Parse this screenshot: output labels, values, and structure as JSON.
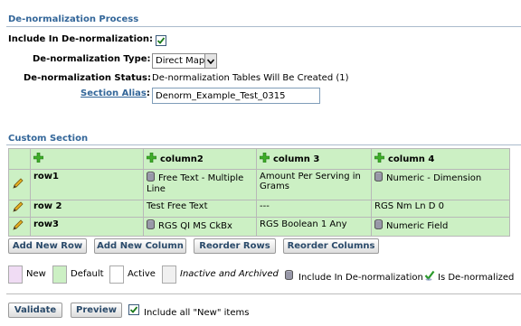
{
  "denorm": {
    "title": "De-normalization Process",
    "include_label": "Include In De-normalization:",
    "include_checked": true,
    "type_label": "De-normalization Type:",
    "type_value": "Direct Map",
    "status_label": "De-normalization Status:",
    "status_value": "De-normalization Tables Will Be Created (1)",
    "alias_label": "Section Alias",
    "alias_colon": ":",
    "alias_value": "Denorm_Example_Test_0315"
  },
  "custom": {
    "title": "Custom Section",
    "columns": [
      "column2",
      "column 3",
      "column 4"
    ],
    "rows": [
      {
        "label": "row1",
        "cells": [
          "Free Text - Multiple Line",
          "Amount Per Serving in Grams",
          "Numeric - Dimension"
        ]
      },
      {
        "label": "row 2",
        "cells": [
          "Test Free Text",
          "---",
          "RGS Nm Ln D 0"
        ]
      },
      {
        "label": "row3",
        "cells": [
          "RGS QI MS CkBx",
          "RGS Boolean 1 Any",
          "Numeric Field"
        ]
      }
    ]
  },
  "buttons": {
    "add_row": "Add New Row",
    "add_column": "Add New Column",
    "reorder_rows": "Reorder Rows",
    "reorder_columns": "Reorder Columns",
    "validate": "Validate",
    "preview": "Preview"
  },
  "legend": {
    "new": "New",
    "default": "Default",
    "active": "Active",
    "inactive": "Inactive and Archived",
    "include": "Include In De-normalization",
    "denormalized": "Is De-normalized"
  },
  "footer": {
    "include_new_label": "Include all \"New\" items",
    "include_new_checked": true
  },
  "colors": {
    "new": "#f0dcf4",
    "default": "#ccf0c4",
    "active": "#ffffff",
    "inactive": "#f0f0f0"
  },
  "icons": {
    "checkmark": "checkmark-icon",
    "dropdown": "chevron-down-icon",
    "plus": "green-plus-icon",
    "database": "database-icon",
    "pencil": "pencil-icon",
    "denormalized": "green-check-icon"
  }
}
